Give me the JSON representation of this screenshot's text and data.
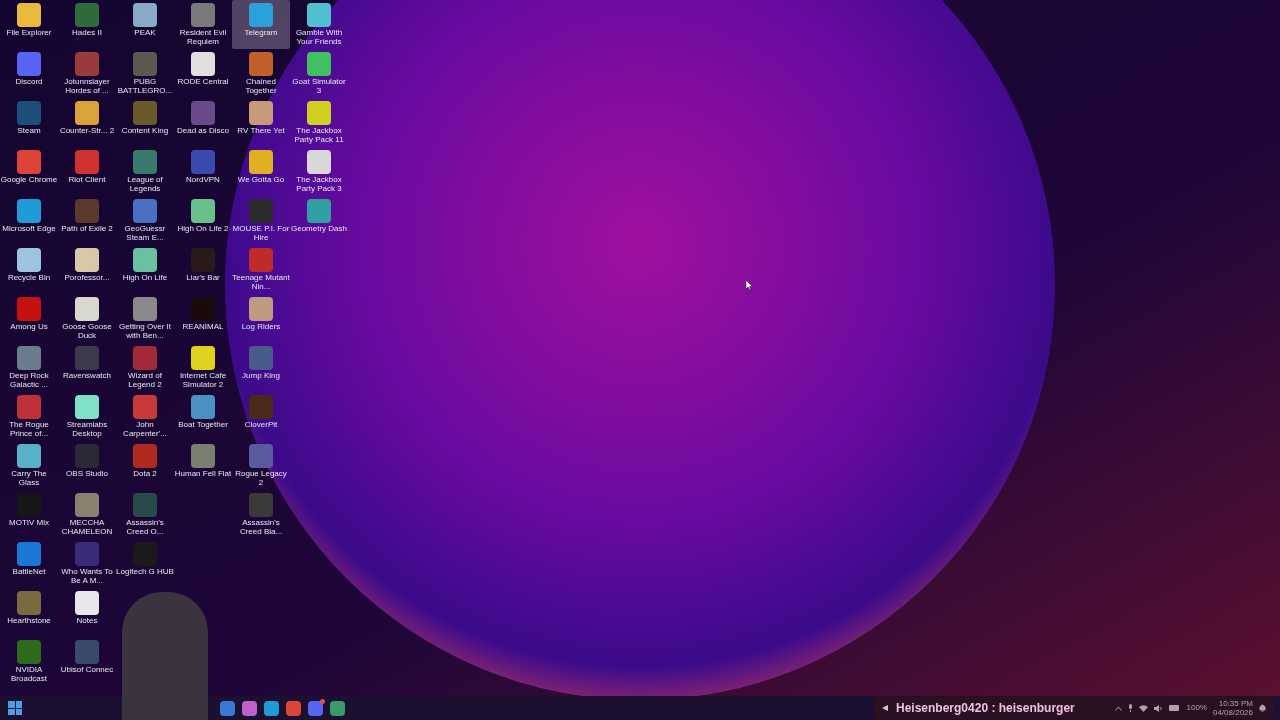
{
  "desktop": {
    "columns": [
      {
        "icons": [
          {
            "label": "File Explorer",
            "color": "#e8b93a",
            "selected": false
          },
          {
            "label": "Discord",
            "color": "#5865f2",
            "selected": false
          },
          {
            "label": "Steam",
            "color": "#1b4f7a",
            "selected": false
          },
          {
            "label": "Google Chrome",
            "color": "#db4437",
            "selected": false
          },
          {
            "label": "Microsoft Edge",
            "color": "#1f9bd8",
            "selected": false
          },
          {
            "label": "Recycle Bin",
            "color": "#9cc3e0",
            "selected": false
          },
          {
            "label": "Among Us",
            "color": "#c51111",
            "selected": false
          },
          {
            "label": "Deep Rock Galactic ...",
            "color": "#6b7d8c",
            "selected": false
          },
          {
            "label": "The Rogue Prince of...",
            "color": "#c0303a",
            "selected": false
          },
          {
            "label": "Carry The Glass",
            "color": "#5ab0c8",
            "selected": false
          },
          {
            "label": "MOTIV Mix",
            "color": "#161616",
            "selected": false
          },
          {
            "label": "BattleNet",
            "color": "#1a78d4",
            "selected": false
          },
          {
            "label": "Hearthstone",
            "color": "#7a6a40",
            "selected": false
          },
          {
            "label": "NVIDIA Broadcast",
            "color": "#2d6a1a",
            "selected": false
          }
        ]
      },
      {
        "icons": [
          {
            "label": "Hades II",
            "color": "#2f6a3a",
            "selected": false
          },
          {
            "label": "Jotunnslayer Hordes of ...",
            "color": "#9a3a3a",
            "selected": false
          },
          {
            "label": "Counter-Str... 2",
            "color": "#d9a33a",
            "selected": false
          },
          {
            "label": "Riot Client",
            "color": "#d0302f",
            "selected": false
          },
          {
            "label": "Path of Exile 2",
            "color": "#5a3a2a",
            "selected": false
          },
          {
            "label": "Porofessor...",
            "color": "#d8c8a8",
            "selected": false
          },
          {
            "label": "Goose Goose Duck",
            "color": "#d8d8d0",
            "selected": false
          },
          {
            "label": "Ravenswatch",
            "color": "#3a3a4a",
            "selected": false
          },
          {
            "label": "Streamlabs Desktop",
            "color": "#80e0c8",
            "selected": false
          },
          {
            "label": "OBS Studio",
            "color": "#2a2a36",
            "selected": false
          },
          {
            "label": "MECCHA CHAMELEON",
            "color": "#8a8070",
            "selected": false
          },
          {
            "label": "Who Wants To Be A M...",
            "color": "#3a2a7a",
            "selected": false
          },
          {
            "label": "Notes",
            "color": "#e8e8ec",
            "selected": false
          },
          {
            "label": "Ubisof Connec",
            "color": "#3a4a6a",
            "selected": false
          }
        ]
      },
      {
        "icons": [
          {
            "label": "PEAK",
            "color": "#8aa8c8",
            "selected": false
          },
          {
            "label": "PUBG BATTLEGRO...",
            "color": "#5a5a50",
            "selected": false
          },
          {
            "label": "Content King",
            "color": "#6a5a2a",
            "selected": false
          },
          {
            "label": "League of Legends",
            "color": "#3a7a6a",
            "selected": false
          },
          {
            "label": "GeoGuessr Steam E...",
            "color": "#4a70c0",
            "selected": false
          },
          {
            "label": "High On Life",
            "color": "#6ac0a0",
            "selected": false
          },
          {
            "label": "Getting Over It with Ben...",
            "color": "#8a8a8a",
            "selected": false
          },
          {
            "label": "Wizard of Legend 2",
            "color": "#a02a3a",
            "selected": false
          },
          {
            "label": "John Carpenter'...",
            "color": "#c83a3a",
            "selected": false
          },
          {
            "label": "Dota 2",
            "color": "#b02a20",
            "selected": false
          },
          {
            "label": "Assassin's Creed O...",
            "color": "#2a4a4a",
            "selected": false
          },
          {
            "label": "Logitech G HUB",
            "color": "#1a1a1a",
            "selected": false
          }
        ]
      },
      {
        "icons": [
          {
            "label": "Resident Evil Requiem",
            "color": "#7a7a7a",
            "selected": false
          },
          {
            "label": "RODE Central",
            "color": "#e0e0e0",
            "selected": false
          },
          {
            "label": "Dead as Disco",
            "color": "#6a4a8a",
            "selected": false
          },
          {
            "label": "NordVPN",
            "color": "#3a4ab0",
            "selected": false
          },
          {
            "label": "High On Life 2",
            "color": "#6ac08a",
            "selected": false
          },
          {
            "label": "Liar's Bar",
            "color": "#2a1a1a",
            "selected": false
          },
          {
            "label": "REANIMAL",
            "color": "#1a0a0a",
            "selected": false
          },
          {
            "label": "Internet Cafe Simulator 2",
            "color": "#e0d020",
            "selected": false
          },
          {
            "label": "Boat Together",
            "color": "#4a90c0",
            "selected": false
          },
          {
            "label": "Human Fell Flat",
            "color": "#7a8070",
            "selected": false
          }
        ]
      },
      {
        "icons": [
          {
            "label": "Telegram",
            "color": "#2aa1da",
            "selected": true
          },
          {
            "label": "Chained Together",
            "color": "#c0602a",
            "selected": false
          },
          {
            "label": "RV There Yet",
            "color": "#c89a7a",
            "selected": false
          },
          {
            "label": "We Gotta Go",
            "color": "#e0b020",
            "selected": false
          },
          {
            "label": "MOUSE P.I. For Hire",
            "color": "#2a2a2a",
            "selected": false
          },
          {
            "label": "Teenage Mutant Nin...",
            "color": "#c02a2a",
            "selected": false
          },
          {
            "label": "Log Riders",
            "color": "#c09a80",
            "selected": false
          },
          {
            "label": "Jump King",
            "color": "#4a5a8a",
            "selected": false
          },
          {
            "label": "CloverPit",
            "color": "#4a2a1a",
            "selected": false
          },
          {
            "label": "Rogue Legacy 2",
            "color": "#5a5aa0",
            "selected": false
          },
          {
            "label": "Assassin's Creed Bla...",
            "color": "#3a3a3a",
            "selected": false
          }
        ]
      },
      {
        "icons": [
          {
            "label": "Gamble With Your Friends",
            "color": "#50c0d0",
            "selected": false
          },
          {
            "label": "Goat Simulator 3",
            "color": "#40c060",
            "selected": false
          },
          {
            "label": "The Jackbox Party Pack 11",
            "color": "#d0d020",
            "selected": false
          },
          {
            "label": "The Jackbox Party Pack 3",
            "color": "#d8d8d8",
            "selected": false
          },
          {
            "label": "Geometry Dash",
            "color": "#30a0a0",
            "selected": false
          }
        ]
      }
    ]
  },
  "taskbar": {
    "apps": [
      {
        "color": "#3a78d8",
        "badge": false
      },
      {
        "color": "#c060d0",
        "badge": false
      },
      {
        "color": "#1f9bd8",
        "badge": false
      },
      {
        "color": "#db4437",
        "badge": false
      },
      {
        "color": "#5865f2",
        "badge": true
      },
      {
        "color": "#3a9a6a",
        "badge": false
      }
    ],
    "chat": "Heisenberg0420 : heisenburger",
    "battery": "100%",
    "time": "10:35 PM",
    "date": "04/08/2026"
  }
}
